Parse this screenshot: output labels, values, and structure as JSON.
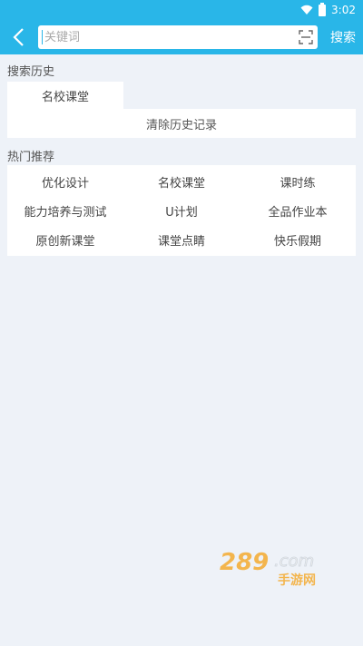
{
  "status": {
    "time": "3:02"
  },
  "search": {
    "placeholder": "关键词",
    "button_label": "搜索"
  },
  "history": {
    "title": "搜索历史",
    "items": [
      "名校课堂"
    ],
    "clear_label": "清除历史记录"
  },
  "hot": {
    "title": "热门推荐",
    "items": [
      "优化设计",
      "名校课堂",
      "课时练",
      "能力培养与测试",
      "U计划",
      "全品作业本",
      "原创新课堂",
      "课堂点睛",
      "快乐假期"
    ]
  },
  "watermark": {
    "text": "289.com 手游网"
  },
  "colors": {
    "accent": "#29b6e8",
    "background": "#eef2f8"
  }
}
